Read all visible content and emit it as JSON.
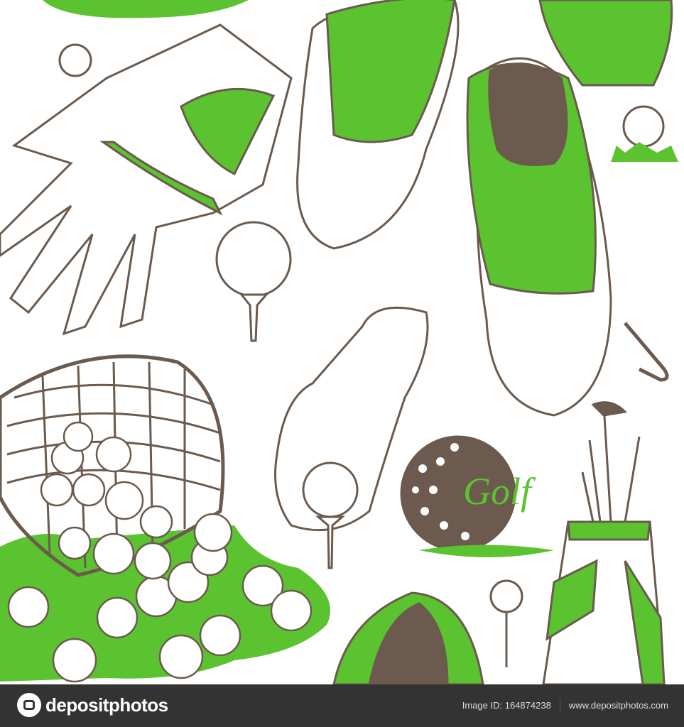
{
  "illustration": {
    "golf_text": "Golf",
    "colors": {
      "green": "#5cc330",
      "brown": "#6b5a4d",
      "footer": "#333333"
    }
  },
  "footer": {
    "logo_text": "depositphotos",
    "image_id": "Image ID: 164874238",
    "site": "www.depositphotos.com"
  }
}
